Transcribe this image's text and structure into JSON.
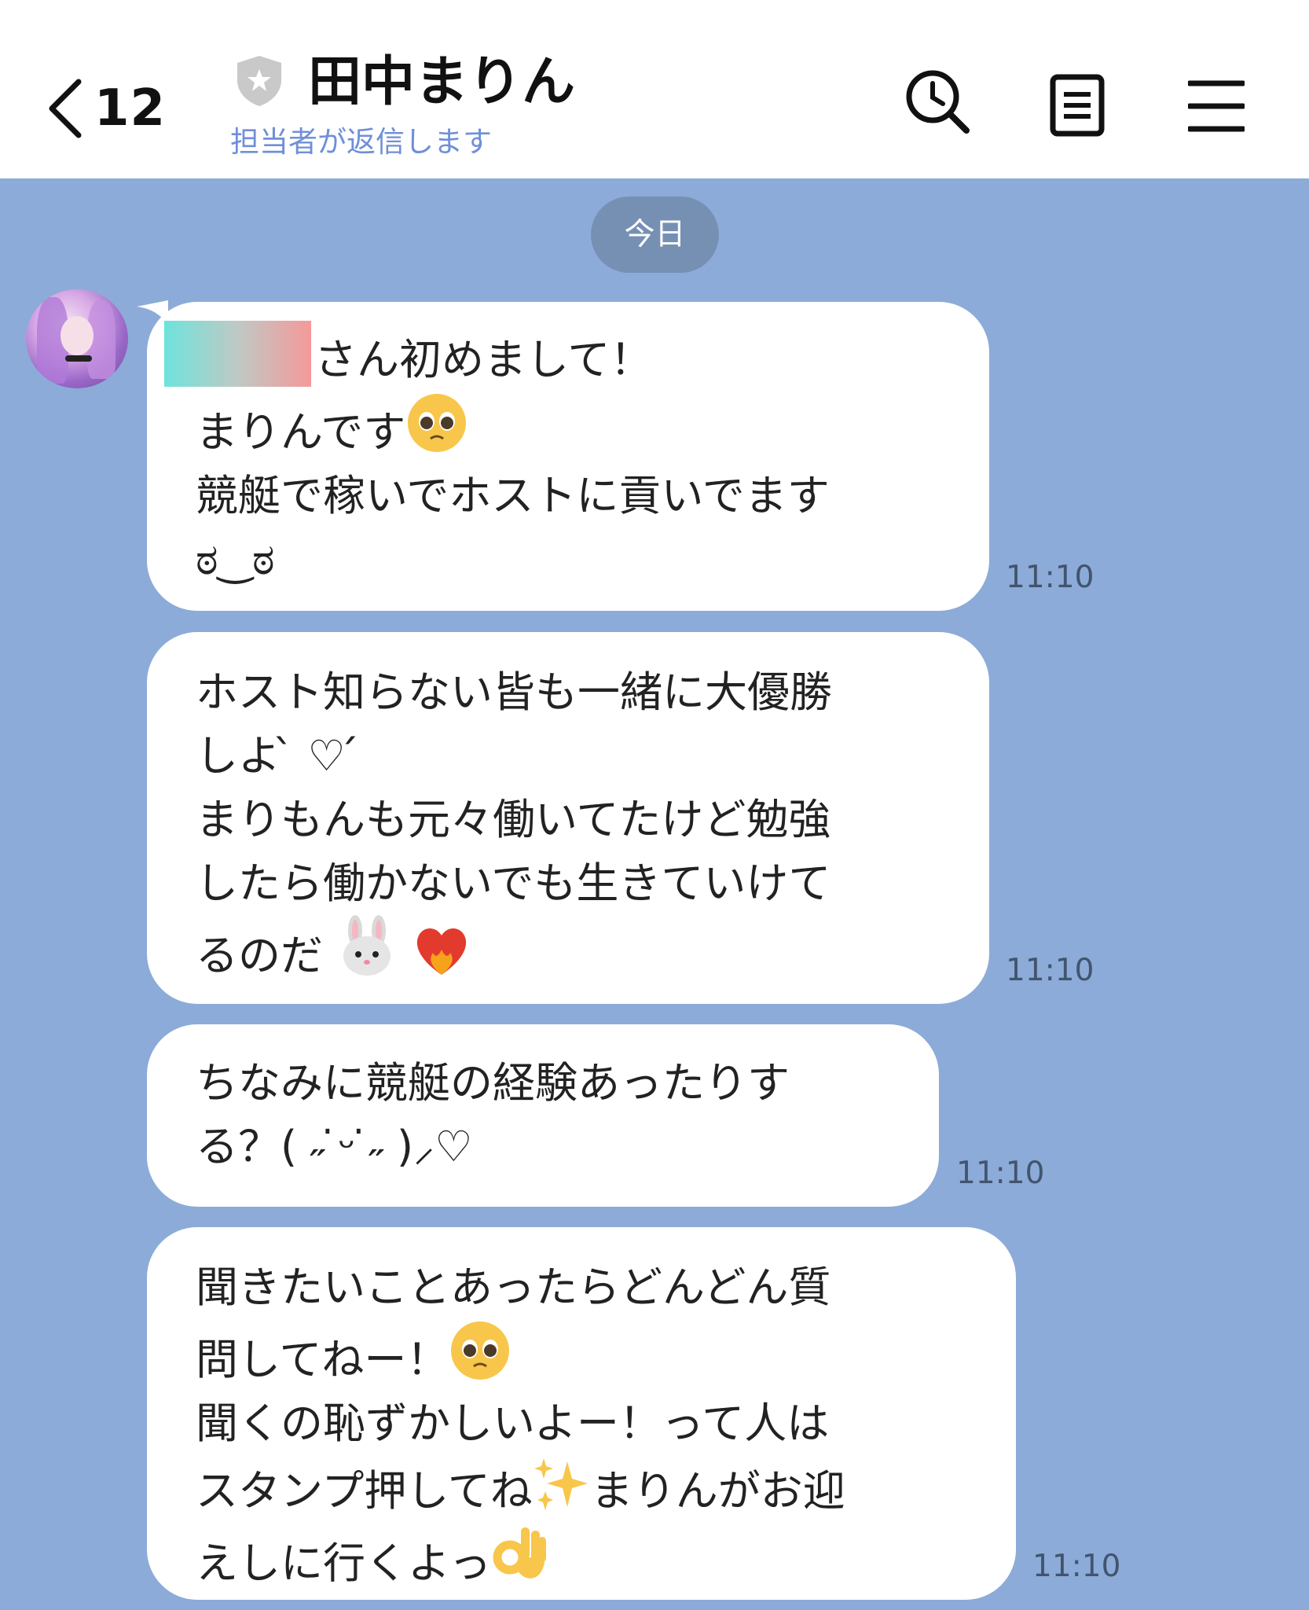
{
  "header": {
    "back_count": "12",
    "title": "田中まりん",
    "subtitle": "担当者が返信します",
    "icons": [
      "back-chevron-icon",
      "shield-star-icon",
      "clock-search-icon",
      "note-icon",
      "menu-icon"
    ]
  },
  "date_chip": "今日",
  "messages": [
    {
      "lines": [
        "さん初めまして！",
        "まりんです",
        "競艇で稼いでホストに貢いでます",
        "ಠ‿ಠ"
      ],
      "time": "11:10",
      "emojis": [
        "pleading-face-emoji"
      ]
    },
    {
      "lines": [
        "ホスト知らない皆も一緒に大優勝",
        "しよ ̀ ♡ ́",
        "まりもんも元々働いてたけど勉強",
        "したら働かないでも生きていけて",
        "るのだ"
      ],
      "time": "11:10",
      "emojis": [
        "rabbit-face-emoji",
        "heart-on-fire-emoji"
      ]
    },
    {
      "lines": [
        "ちなみに競艇の経験あったりす",
        "る？( ˶ ̇ᵕ ̇˶ )⸝♡"
      ],
      "time": "11:10"
    },
    {
      "lines": [
        "聞きたいことあったらどんどん質",
        "問してねー！",
        "聞くの恥ずかしいよー！って人は",
        "スタンプ押してね",
        "まりんがお迎",
        "えしに行くよっ"
      ],
      "time": "11:10",
      "emojis": [
        "pleading-face-emoji",
        "sparkles-emoji",
        "ok-hand-emoji"
      ]
    }
  ],
  "colors": {
    "chat_background": "#8cabd8",
    "header_background": "#ffffff",
    "subtitle": "#6f8fd8",
    "date_chip": "#7690b4",
    "bubble": "#ffffff"
  }
}
